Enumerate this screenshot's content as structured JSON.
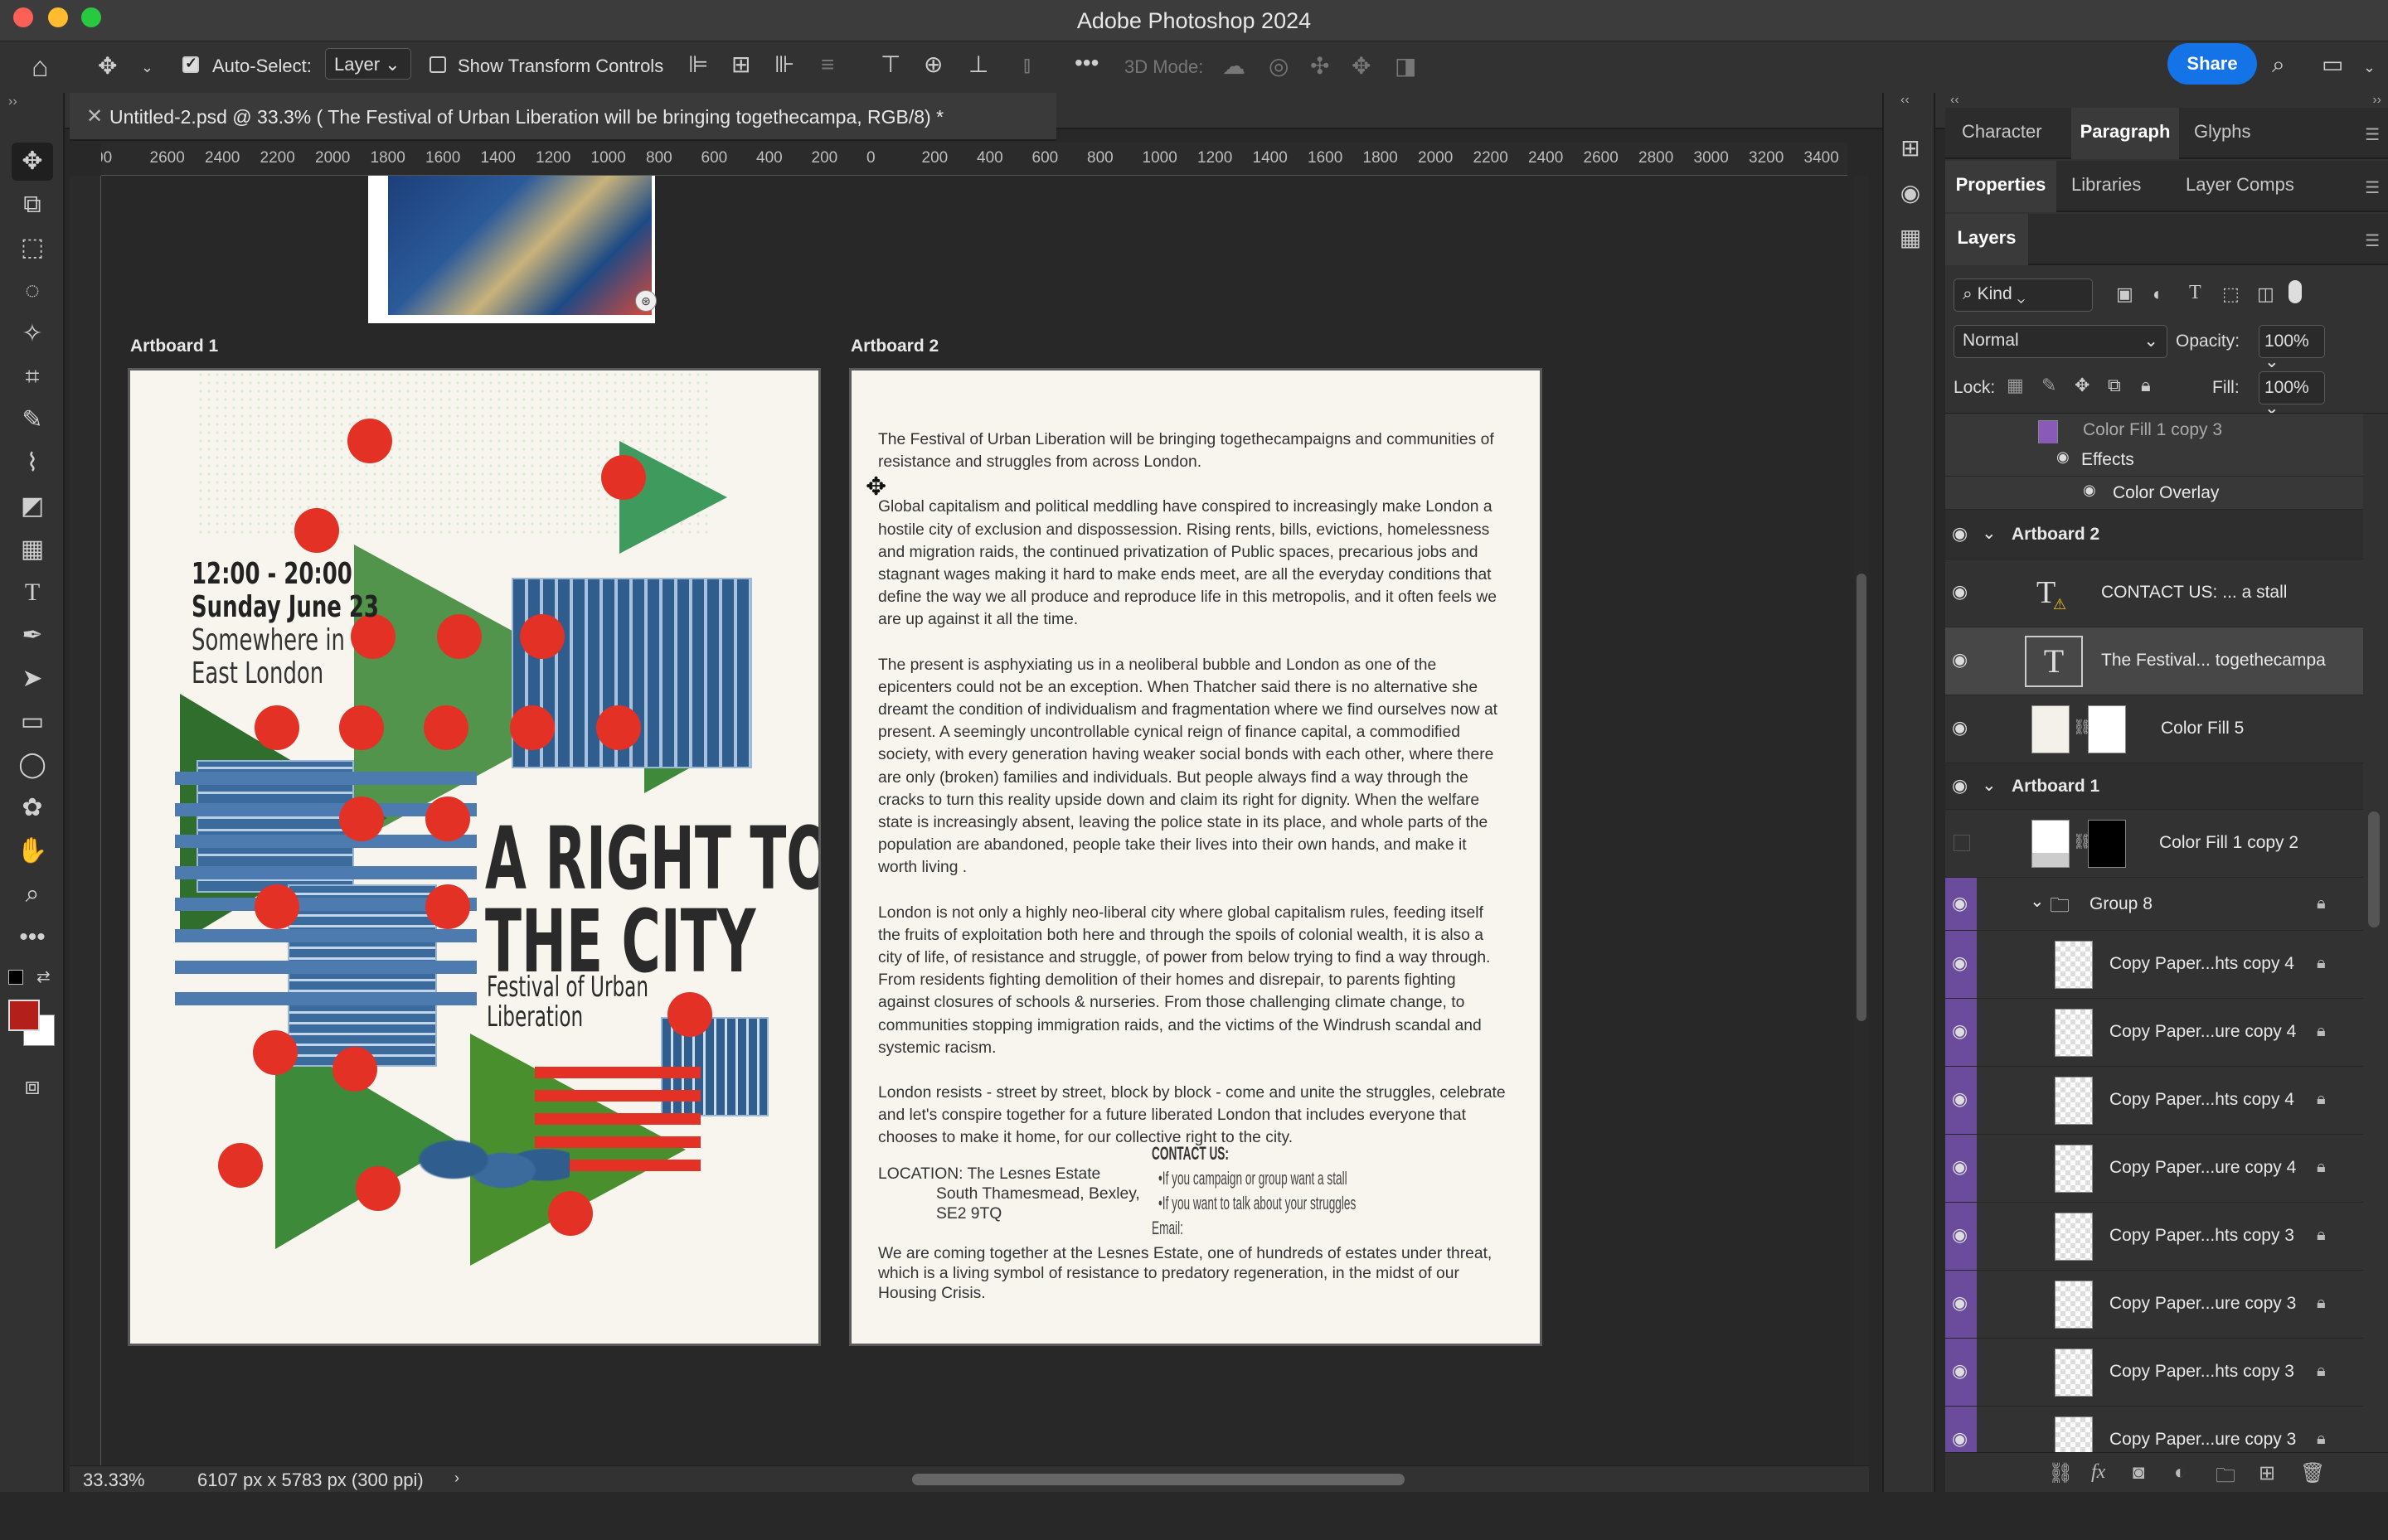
{
  "app": {
    "title": "Adobe Photoshop 2024"
  },
  "options_bar": {
    "auto_select_label": "Auto-Select:",
    "auto_select_value": "Layer",
    "show_transform_label": "Show Transform Controls",
    "mode_3d_label": "3D Mode:",
    "share_label": "Share"
  },
  "document": {
    "tab_title": "Untitled-2.psd @ 33.3% ( The Festival of Urban Liberation will be bringing togethecampa, RGB/8) *",
    "ruler_ticks": [
      "00",
      "2600",
      "2400",
      "2200",
      "2000",
      "1800",
      "1600",
      "1400",
      "1200",
      "1000",
      "800",
      "600",
      "400",
      "200",
      "0",
      "200",
      "400",
      "600",
      "800",
      "1000",
      "1200",
      "1400",
      "1600",
      "1800",
      "2000",
      "2200",
      "2400",
      "2600",
      "2800",
      "3000",
      "3200",
      "3400"
    ],
    "zoom": "33.33%",
    "dimensions": "6107 px x 5783 px (300 ppi)"
  },
  "artboard1": {
    "label": "Artboard 1",
    "time": "12:00 - 20:00",
    "date": "Sunday June 23",
    "place1": "Somewhere in",
    "place2": "East London",
    "headline1": "A RIGHT TO",
    "headline2": "THE CITY",
    "sub1": "Festival of Urban",
    "sub2": "Liberation"
  },
  "artboard2": {
    "label": "Artboard 2",
    "paragraphs": [
      "The Festival of Urban Liberation will be bringing togethecampaigns and communities of resistance and struggles from across London.",
      "Global capitalism and political meddling have conspired to increasingly make London a hostile city of exclusion and dispossession. Rising rents, bills, evictions, homelessness and migration raids, the continued privatization of Public spaces, precarious jobs and stagnant wages making it hard to make ends meet,  are all the everyday conditions that define the way we all produce and reproduce life in this metropolis, and it often feels we are up against it all the time.",
      "The present is asphyxiating us in a neoliberal bubble and London as one of the epicenters could not be an exception. When Thatcher said there is no alternative she dreamt the condition of individualism and fragmentation where we find ourselves now at present. A seemingly uncontrollable cynical reign of finance capital, a commodified society, with every generation having weaker social bonds with each other, where there are only (broken) families and individuals. But people always find a way through the cracks to turn this reality upside down and claim its right for dignity. When the welfare state is increasingly absent, leaving the police state in its place, and whole parts of the population are abandoned, people take their lives  into their own hands, and make it worth living .",
      "London is not only a highly neo-liberal city where global capitalism rules, feeding itself the fruits of exploitation both here and through the spoils of colonial wealth, it is also a city of life, of resistance and struggle, of power from below trying to find a way through. From residents fighting demolition of their homes and disrepair, to parents fighting against closures of schools & nurseries. From those challenging climate change, to communities stopping immigration raids, and the victims of the Windrush scandal and systemic racism.",
      "London resists - street by street, block by block - come and unite the struggles, celebrate and let's conspire together for a future liberated London that includes everyone that chooses to make it home, for our collective right to the city."
    ],
    "location_label": "LOCATION: The Lesnes Estate",
    "location_line2": "South Thamesmead, Bexley,",
    "location_line3": "SE2 9TQ",
    "contact_title": "CONTACT US:",
    "contact_item1": "•If you campaign or group want a stall",
    "contact_item2": "•If you want to talk about your struggles",
    "contact_email": "Email:",
    "closing": "We are coming together at the Lesnes Estate, one of hundreds of estates under threat, which is a living symbol of resistance to predatory regeneration, in the midst of our Housing Crisis."
  },
  "panels": {
    "tabs_row1": [
      "Character",
      "Paragraph",
      "Glyphs"
    ],
    "tabs_row2": [
      "Properties",
      "Libraries",
      "Layer Comps"
    ],
    "layers_tab": "Layers",
    "filter_kind": "Kind",
    "blend_mode": "Normal",
    "opacity_label": "Opacity:",
    "opacity_value": "100%",
    "lock_label": "Lock:",
    "fill_label": "Fill:",
    "fill_value": "100%"
  },
  "layers": {
    "top_partial": "Color Fill 1 copy 3",
    "effects": "Effects",
    "color_overlay": "Color Overlay",
    "artboard2": "Artboard 2",
    "contact": "CONTACT US:  ... a stall",
    "festival": "The Festival... togethecampa",
    "colorfill5": "Color Fill 5",
    "artboard1": "Artboard 1",
    "colorfill1copy2": "Color Fill 1 copy 2",
    "group8": "Group 8",
    "items": [
      "Copy Paper...hts copy 4",
      "Copy Paper...ure copy 4",
      "Copy Paper...hts copy 4",
      "Copy Paper...ure copy 4",
      "Copy Paper...hts copy 3",
      "Copy Paper...ure copy 3",
      "Copy Paper...hts copy 3",
      "Copy Paper...ure copy 3"
    ]
  },
  "colors": {
    "accent": "#1473e6",
    "poster_red": "#e33225",
    "poster_green": "#3f8a3a",
    "poster_blue": "#4d7bb0",
    "layer_purple": "#6a4b9c"
  }
}
